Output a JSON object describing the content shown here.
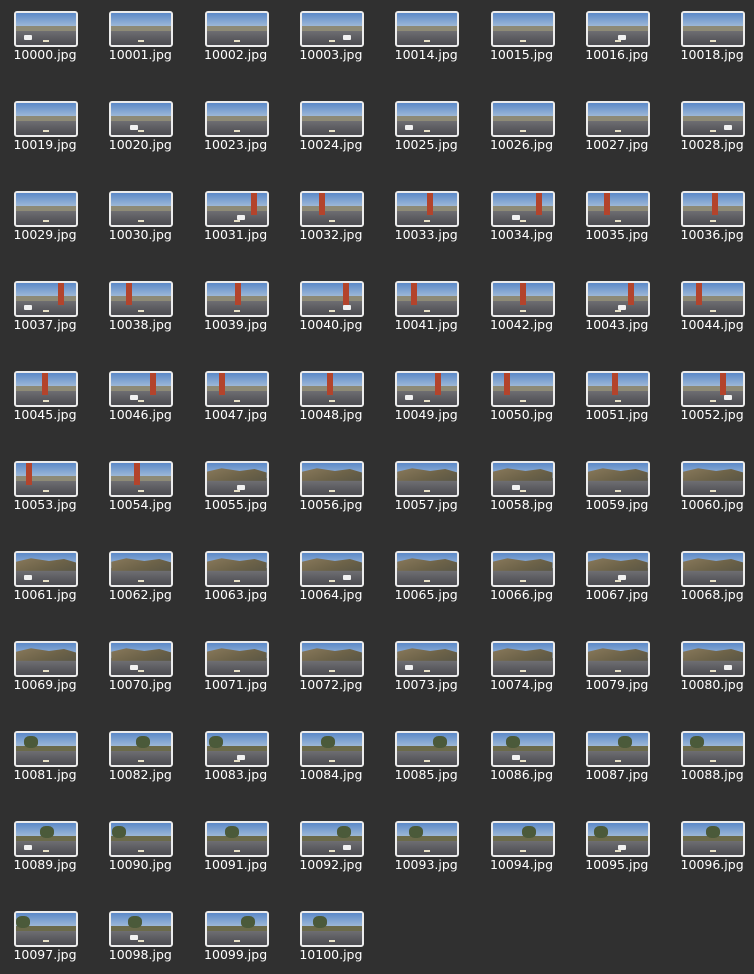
{
  "files": [
    {
      "name": "10000.jpg",
      "scene": "city"
    },
    {
      "name": "10001.jpg",
      "scene": "city"
    },
    {
      "name": "10002.jpg",
      "scene": "city"
    },
    {
      "name": "10003.jpg",
      "scene": "city"
    },
    {
      "name": "10014.jpg",
      "scene": "city"
    },
    {
      "name": "10015.jpg",
      "scene": "city"
    },
    {
      "name": "10016.jpg",
      "scene": "city"
    },
    {
      "name": "10018.jpg",
      "scene": "city"
    },
    {
      "name": "10019.jpg",
      "scene": "city"
    },
    {
      "name": "10020.jpg",
      "scene": "city"
    },
    {
      "name": "10023.jpg",
      "scene": "city"
    },
    {
      "name": "10024.jpg",
      "scene": "city"
    },
    {
      "name": "10025.jpg",
      "scene": "city"
    },
    {
      "name": "10026.jpg",
      "scene": "city"
    },
    {
      "name": "10027.jpg",
      "scene": "city"
    },
    {
      "name": "10028.jpg",
      "scene": "city"
    },
    {
      "name": "10029.jpg",
      "scene": "city"
    },
    {
      "name": "10030.jpg",
      "scene": "city"
    },
    {
      "name": "10031.jpg",
      "scene": "bridge"
    },
    {
      "name": "10032.jpg",
      "scene": "bridge"
    },
    {
      "name": "10033.jpg",
      "scene": "bridge"
    },
    {
      "name": "10034.jpg",
      "scene": "bridge"
    },
    {
      "name": "10035.jpg",
      "scene": "bridge"
    },
    {
      "name": "10036.jpg",
      "scene": "bridge"
    },
    {
      "name": "10037.jpg",
      "scene": "bridge"
    },
    {
      "name": "10038.jpg",
      "scene": "bridge"
    },
    {
      "name": "10039.jpg",
      "scene": "bridge"
    },
    {
      "name": "10040.jpg",
      "scene": "bridge"
    },
    {
      "name": "10041.jpg",
      "scene": "bridge"
    },
    {
      "name": "10042.jpg",
      "scene": "bridge"
    },
    {
      "name": "10043.jpg",
      "scene": "bridge"
    },
    {
      "name": "10044.jpg",
      "scene": "bridge"
    },
    {
      "name": "10045.jpg",
      "scene": "bridge"
    },
    {
      "name": "10046.jpg",
      "scene": "bridge"
    },
    {
      "name": "10047.jpg",
      "scene": "bridge"
    },
    {
      "name": "10048.jpg",
      "scene": "bridge"
    },
    {
      "name": "10049.jpg",
      "scene": "bridge"
    },
    {
      "name": "10050.jpg",
      "scene": "bridge"
    },
    {
      "name": "10051.jpg",
      "scene": "bridge"
    },
    {
      "name": "10052.jpg",
      "scene": "bridge"
    },
    {
      "name": "10053.jpg",
      "scene": "bridge"
    },
    {
      "name": "10054.jpg",
      "scene": "bridge"
    },
    {
      "name": "10055.jpg",
      "scene": "hills"
    },
    {
      "name": "10056.jpg",
      "scene": "hills"
    },
    {
      "name": "10057.jpg",
      "scene": "hills"
    },
    {
      "name": "10058.jpg",
      "scene": "hills"
    },
    {
      "name": "10059.jpg",
      "scene": "hills"
    },
    {
      "name": "10060.jpg",
      "scene": "hills"
    },
    {
      "name": "10061.jpg",
      "scene": "hills"
    },
    {
      "name": "10062.jpg",
      "scene": "hills"
    },
    {
      "name": "10063.jpg",
      "scene": "hills"
    },
    {
      "name": "10064.jpg",
      "scene": "hills"
    },
    {
      "name": "10065.jpg",
      "scene": "hills"
    },
    {
      "name": "10066.jpg",
      "scene": "hills"
    },
    {
      "name": "10067.jpg",
      "scene": "hills"
    },
    {
      "name": "10068.jpg",
      "scene": "hills"
    },
    {
      "name": "10069.jpg",
      "scene": "hills"
    },
    {
      "name": "10070.jpg",
      "scene": "hills"
    },
    {
      "name": "10071.jpg",
      "scene": "hills"
    },
    {
      "name": "10072.jpg",
      "scene": "hills"
    },
    {
      "name": "10073.jpg",
      "scene": "hills"
    },
    {
      "name": "10074.jpg",
      "scene": "hills"
    },
    {
      "name": "10079.jpg",
      "scene": "hills"
    },
    {
      "name": "10080.jpg",
      "scene": "hills"
    },
    {
      "name": "10081.jpg",
      "scene": "trees"
    },
    {
      "name": "10082.jpg",
      "scene": "trees"
    },
    {
      "name": "10083.jpg",
      "scene": "trees"
    },
    {
      "name": "10084.jpg",
      "scene": "trees"
    },
    {
      "name": "10085.jpg",
      "scene": "trees"
    },
    {
      "name": "10086.jpg",
      "scene": "trees"
    },
    {
      "name": "10087.jpg",
      "scene": "trees"
    },
    {
      "name": "10088.jpg",
      "scene": "trees"
    },
    {
      "name": "10089.jpg",
      "scene": "trees"
    },
    {
      "name": "10090.jpg",
      "scene": "trees"
    },
    {
      "name": "10091.jpg",
      "scene": "trees"
    },
    {
      "name": "10092.jpg",
      "scene": "trees"
    },
    {
      "name": "10093.jpg",
      "scene": "trees"
    },
    {
      "name": "10094.jpg",
      "scene": "trees"
    },
    {
      "name": "10095.jpg",
      "scene": "trees"
    },
    {
      "name": "10096.jpg",
      "scene": "trees"
    },
    {
      "name": "10097.jpg",
      "scene": "trees"
    },
    {
      "name": "10098.jpg",
      "scene": "trees"
    },
    {
      "name": "10099.jpg",
      "scene": "trees"
    },
    {
      "name": "10100.jpg",
      "scene": "trees"
    }
  ],
  "colors": {
    "background": "#303030",
    "label_text": "#ffffff",
    "thumb_border": "#ececec",
    "bridge_red": "#b3442c"
  }
}
